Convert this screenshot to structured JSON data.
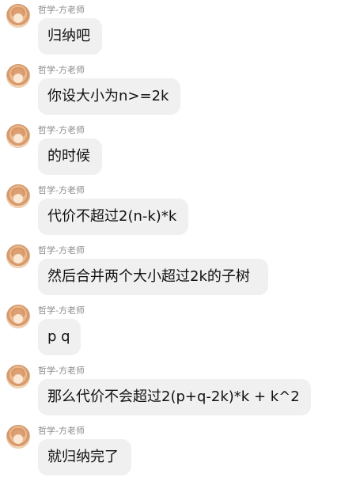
{
  "messages": [
    {
      "sender": "哲学-方老师",
      "text": "归纳吧"
    },
    {
      "sender": "哲学-方老师",
      "text": "你设大小为n>=2k"
    },
    {
      "sender": "哲学-方老师",
      "text": "的时候"
    },
    {
      "sender": "哲学-方老师",
      "text": "代价不超过2(n-k)*k"
    },
    {
      "sender": "哲学-方老师",
      "text": "然后合并两个大小超过2k的子树"
    },
    {
      "sender": "哲学-方老师",
      "text": "p q"
    },
    {
      "sender": "哲学-方老师",
      "text": "那么代价不会超过2(p+q-2k)*k + k^2"
    },
    {
      "sender": "哲学-方老师",
      "text": "就归纳完了"
    }
  ],
  "icons": {
    "avatar": "user-avatar-icon"
  }
}
